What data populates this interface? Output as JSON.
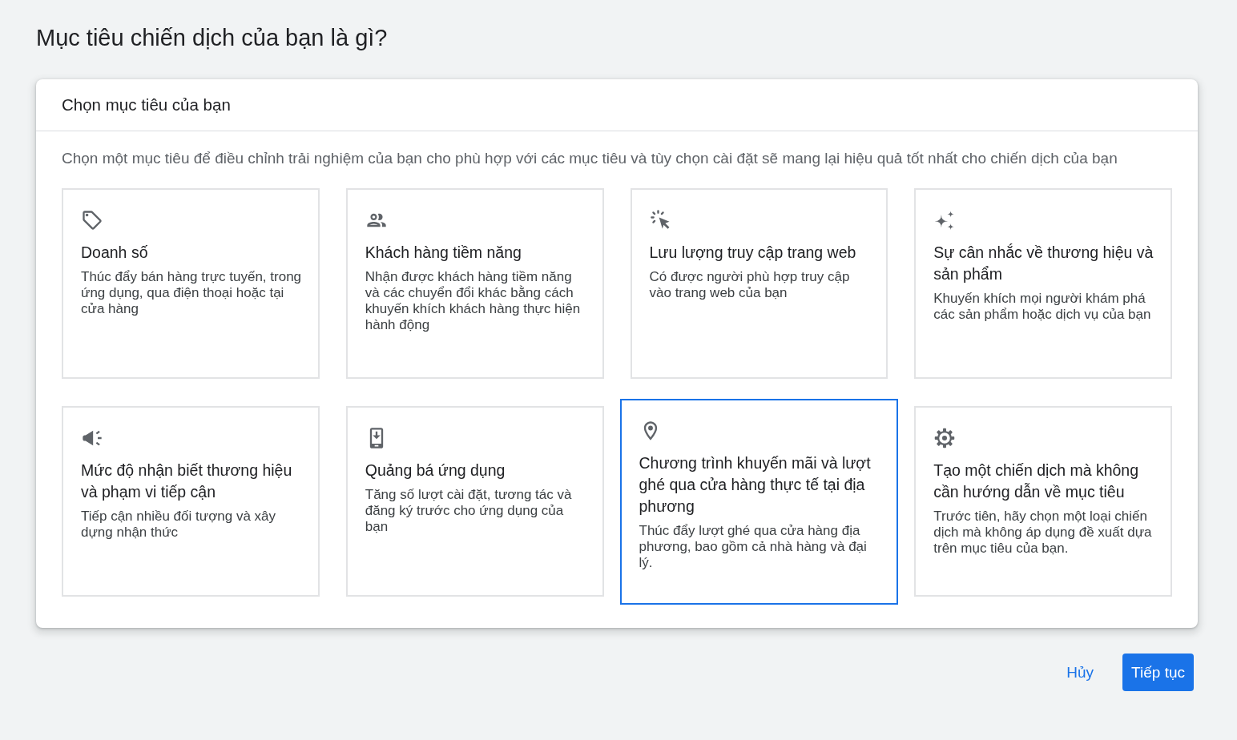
{
  "page_title": "Mục tiêu chiến dịch của bạn là gì?",
  "panel": {
    "header": "Chọn mục tiêu của bạn",
    "description": "Chọn một mục tiêu để điều chỉnh trải nghiệm của bạn cho phù hợp với các mục tiêu và tùy chọn cài đặt sẽ mang lại hiệu quả tốt nhất cho chiến dịch của bạn",
    "goals": [
      {
        "kind": "sales",
        "title": "Doanh số",
        "description": "Thúc đẩy bán hàng trực tuyến, trong ứng dụng, qua điện thoại hoặc tại cửa hàng",
        "selected": false
      },
      {
        "kind": "leads",
        "title": "Khách hàng tiềm năng",
        "description": "Nhận được khách hàng tiềm năng và các chuyển đổi khác bằng cách khuyến khích khách hàng thực hiện hành động",
        "selected": false
      },
      {
        "kind": "traffic",
        "title": "Lưu lượng truy cập trang web",
        "description": "Có được người phù hợp truy cập vào trang web của bạn",
        "selected": false
      },
      {
        "kind": "consideration",
        "title": "Sự cân nhắc về thương hiệu và sản phẩm",
        "description": "Khuyến khích mọi người khám phá các sản phẩm hoặc dịch vụ của bạn",
        "selected": false
      },
      {
        "kind": "awareness",
        "title": "Mức độ nhận biết thương hiệu và phạm vi tiếp cận",
        "description": "Tiếp cận nhiều đối tượng và xây dựng nhận thức",
        "selected": false
      },
      {
        "kind": "app",
        "title": "Quảng bá ứng dụng",
        "description": "Tăng số lượt cài đặt, tương tác và đăng ký trước cho ứng dụng của bạn",
        "selected": false
      },
      {
        "kind": "local",
        "title": "Chương trình khuyến mãi và lượt ghé qua cửa hàng thực tế tại địa phương",
        "description": "Thúc đẩy lượt ghé qua cửa hàng địa phương, bao gồm cả nhà hàng và đại lý.",
        "selected": true
      },
      {
        "kind": "custom",
        "title": "Tạo một chiến dịch mà không cần hướng dẫn về mục tiêu",
        "description": "Trước tiên, hãy chọn một loại chiến dịch mà không áp dụng đề xuất dựa trên mục tiêu của bạn.",
        "selected": false
      }
    ]
  },
  "actions": [
    {
      "kind": "text",
      "label": "Hủy"
    },
    {
      "kind": "primary",
      "label": "Tiếp tục"
    }
  ]
}
